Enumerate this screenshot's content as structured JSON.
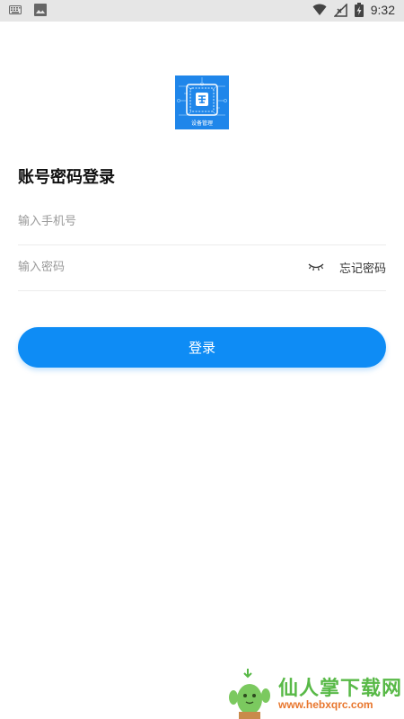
{
  "status_bar": {
    "time": "9:32",
    "icons": [
      "keyboard-icon",
      "image-icon",
      "wifi-icon",
      "no-signal-icon",
      "battery-charging-icon"
    ]
  },
  "logo": {
    "text": "设备管理",
    "colors": {
      "background": "#1f86ea",
      "accent": "#ffffff"
    }
  },
  "login": {
    "title": "账号密码登录",
    "phone_placeholder": "输入手机号",
    "password_placeholder": "输入密码",
    "forgot_label": "忘记密码",
    "submit_label": "登录"
  },
  "watermark": {
    "title": "仙人掌下载网",
    "url": "www.hebxqrc.com"
  },
  "colors": {
    "primary": "#0e8cf5",
    "text_dark": "#111111",
    "placeholder": "#9a9a9a",
    "divider": "#ececec"
  }
}
